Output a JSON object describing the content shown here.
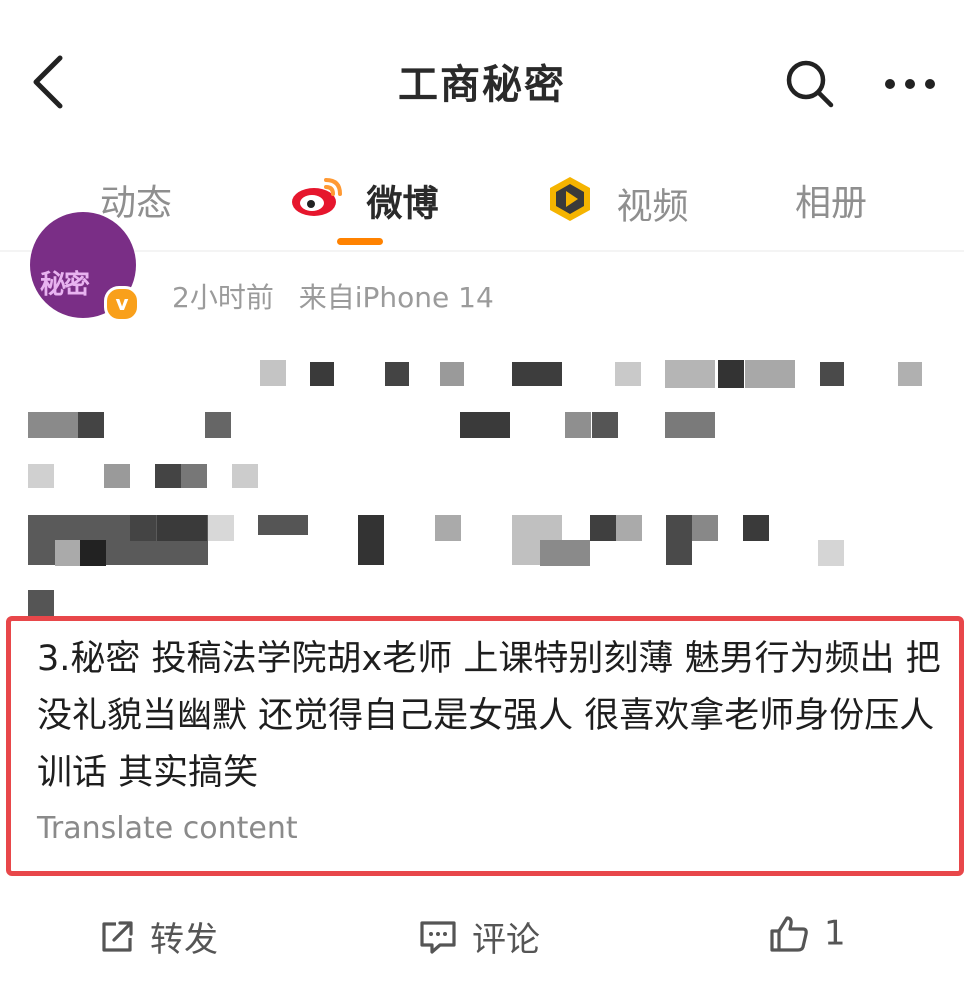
{
  "header": {
    "title": "工商秘密"
  },
  "tabs": [
    {
      "label": "动态",
      "active": false
    },
    {
      "label": "微博",
      "active": true
    },
    {
      "label": "视频",
      "active": false
    },
    {
      "label": "相册",
      "active": false
    }
  ],
  "post": {
    "time": "2小时前",
    "source": "来自iPhone 14",
    "avatar_text": "秘密",
    "verified_badge": "v",
    "text": "3.秘密 投稿法学院胡x老师 上课特别刻薄 魅男行为频出 把没礼貌当幽默 还觉得自己是女强人 很喜欢拿老师身份压人 训话 其实搞笑",
    "translate_label": "Translate content"
  },
  "actions": {
    "repost_label": "转发",
    "comment_label": "评论",
    "like_count": "1"
  },
  "colors": {
    "accent": "#ff8200",
    "highlight_border": "#e8474a",
    "avatar_bg": "#7a2e86"
  }
}
